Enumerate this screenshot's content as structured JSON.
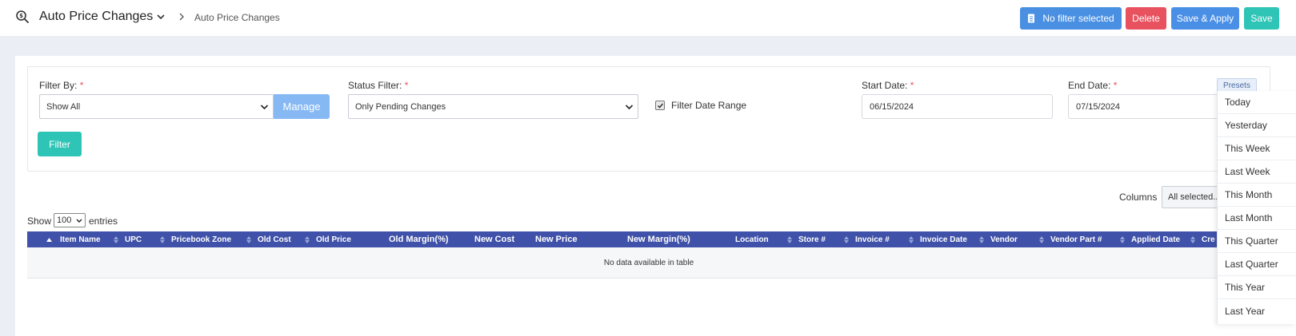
{
  "header": {
    "title": "Auto Price Changes",
    "breadcrumb": "Auto Price Changes",
    "buttons": {
      "no_filter": "No filter selected",
      "delete": "Delete",
      "save_apply": "Save & Apply",
      "save": "Save"
    },
    "icons": [
      "search-dollar-icon",
      "chevron-down-icon",
      "chevron-right-icon",
      "file-icon"
    ]
  },
  "filters": {
    "filter_by": {
      "label": "Filter By:",
      "required": "*",
      "value": "Show All"
    },
    "manage_label": "Manage",
    "status_filter": {
      "label": "Status Filter:",
      "required": "*",
      "value": "Only Pending Changes"
    },
    "date_range": {
      "label": "Filter Date Range",
      "checked": true
    },
    "start_date": {
      "label": "Start Date:",
      "required": "*",
      "value": "06/15/2024"
    },
    "end_date": {
      "label": "End Date:",
      "required": "*",
      "value": "07/15/2024"
    },
    "presets_label": "Presets",
    "filter_button": "Filter"
  },
  "table_controls": {
    "columns_label": "Columns",
    "columns_value": "All selected...",
    "show_label": "Show",
    "show_value": "100",
    "entries_label": "entries"
  },
  "table": {
    "columns": [
      "Item Name",
      "UPC",
      "Pricebook Zone",
      "Old Cost",
      "Old Price",
      "Old Margin(%)",
      "New Cost",
      "New Price",
      "New Margin(%)",
      "Location",
      "Store #",
      "Invoice #",
      "Invoice Date",
      "Vendor",
      "Vendor Part #",
      "Applied Date",
      "Cre"
    ],
    "empty_message": "No data available in table"
  },
  "presets": [
    "Today",
    "Yesterday",
    "This Week",
    "Last Week",
    "This Month",
    "Last Month",
    "This Quarter",
    "Last Quarter",
    "This Year",
    "Last Year"
  ],
  "colors": {
    "primary": "#4a90e2",
    "danger": "#e8525f",
    "teal": "#2ec4b6",
    "table_header": "#3f51a8",
    "required": "#e8525f"
  }
}
